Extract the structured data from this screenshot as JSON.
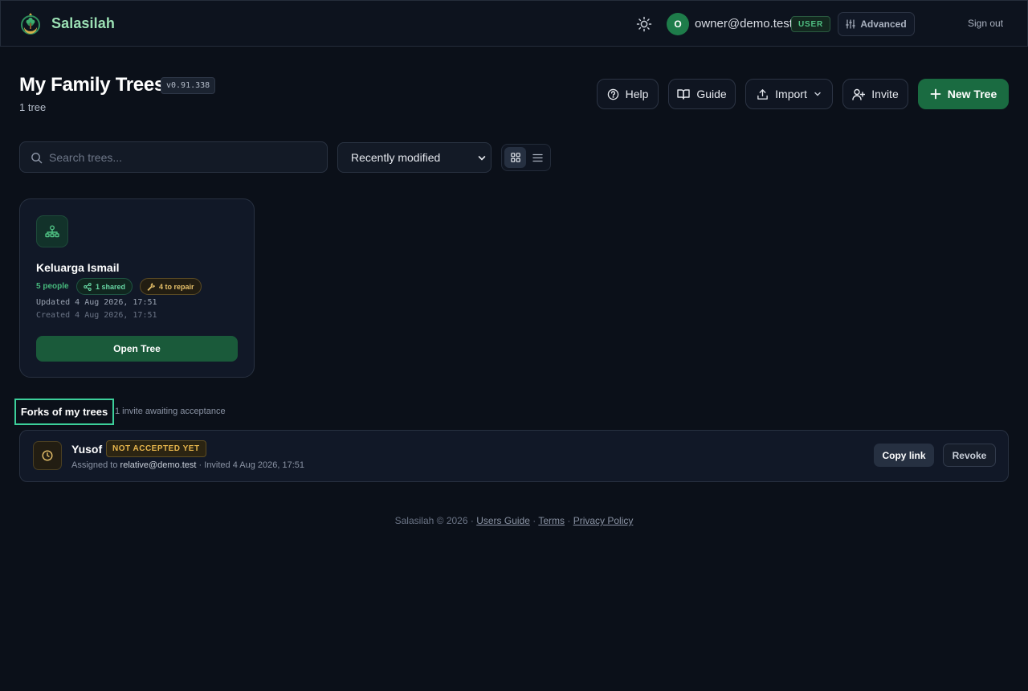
{
  "header": {
    "brand_name": "Salasilah",
    "logo_icon": "crescent-tree-logo",
    "theme_icon": "sun-icon",
    "avatar_initial": "O",
    "user_email": "owner@demo.test",
    "role_badge": "USER",
    "advanced_label": "Advanced",
    "sign_out_label": "Sign out"
  },
  "page": {
    "title": "My Family Trees",
    "version": "v0.91.338",
    "tree_count": "1 tree"
  },
  "toolbar": {
    "help_label": "Help",
    "guide_label": "Guide",
    "import_label": "Import",
    "invite_label": "Invite",
    "new_tree_label": "New Tree"
  },
  "filters": {
    "search_placeholder": "Search trees...",
    "search_value": "",
    "sort_selected": "Recently modified",
    "view_mode": "grid"
  },
  "trees": [
    {
      "name": "Keluarga Ismail",
      "people": "5 people",
      "shared": "1 shared",
      "repair": "4 to repair",
      "updated": "Updated 4 Aug 2026, 17:51",
      "created": "Created 4 Aug 2026, 17:51",
      "open_label": "Open Tree"
    }
  ],
  "forks": {
    "title": "Forks of my trees",
    "subtitle": "1 invite awaiting acceptance",
    "items": [
      {
        "name": "Yusof",
        "status": "NOT ACCEPTED YET",
        "assigned_prefix": "Assigned to ",
        "assigned_email": "relative@demo.test",
        "invited": " · Invited 4 Aug 2026, 17:51",
        "copy_label": "Copy link",
        "revoke_label": "Revoke"
      }
    ]
  },
  "footer": {
    "copyright": "Salasilah © 2026 · ",
    "users_guide": "Users Guide",
    "sep": " · ",
    "terms": "Terms",
    "privacy": "Privacy Policy"
  },
  "colors": {
    "background": "#0b1019",
    "brand": "#9be0b4",
    "accent_green": "#1a6b41",
    "warning": "#e8b64d",
    "highlight": "#3ccf9a"
  }
}
